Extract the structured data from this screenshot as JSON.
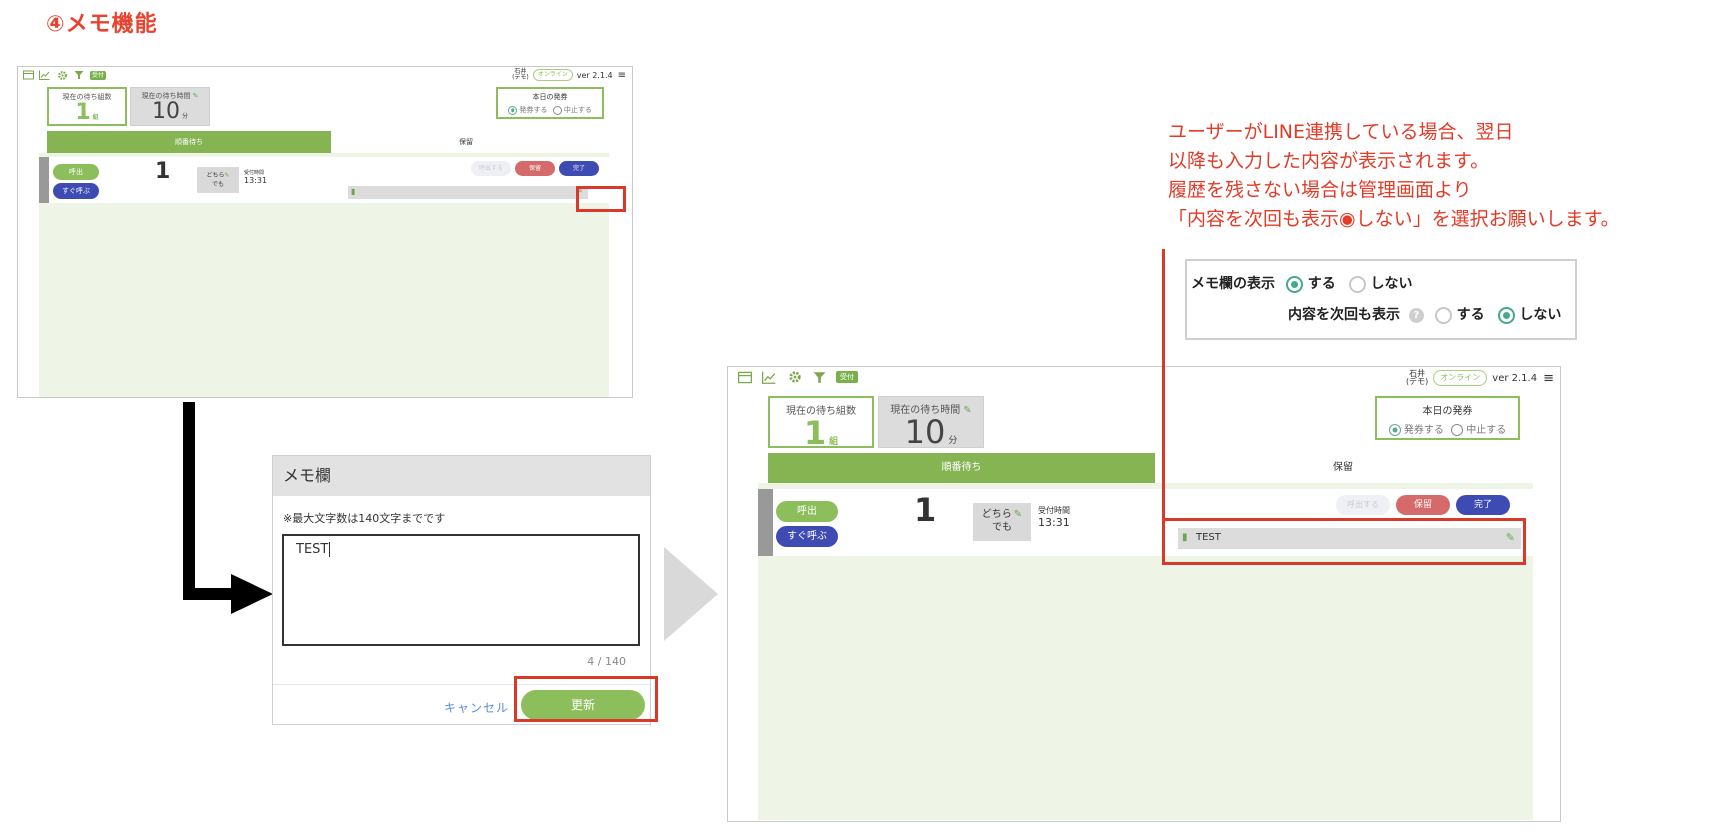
{
  "heading": "④メモ機能",
  "app": {
    "status_badge": "受付",
    "user_name": "石井",
    "user_sub": "(デモ)",
    "online": "オンライン",
    "version": "ver 2.1.4",
    "waiting_groups_label": "現在の待ち組数",
    "waiting_groups_value": "1",
    "waiting_groups_unit": "組",
    "waiting_time_label": "現在の待ち時間",
    "waiting_time_value": "10",
    "waiting_time_unit": "分",
    "issue_title": "本日の発券",
    "issue_on": "発券する",
    "issue_off": "中止する",
    "tab_queue": "順番待ち",
    "tab_hold": "保留",
    "row_number": "1",
    "call_button": "呼出",
    "call_now_button": "すぐ呼ぶ",
    "who_line1": "どちら",
    "who_line2": "でも",
    "reception_time_label": "受付時間",
    "reception_time": "13:31",
    "hold_button": "保留",
    "done_button": "完了",
    "faded_button": "呼出する",
    "memo_value": "TEST"
  },
  "dialog": {
    "title": "メモ欄",
    "hint": "※最大文字数は140文字までです",
    "text": "TEST",
    "counter": "4 / 140",
    "cancel": "キャンセル",
    "update": "更新"
  },
  "annotation": {
    "text": "ユーザーがLINE連携している場合、翌日\n以降も入力した内容が表示されます。\n履歴を残さない場合は管理画面より\n「内容を次回も表示◉しない」を選択お願いします。"
  },
  "settings": {
    "memo_display_label": "メモ欄の表示",
    "carry_over_label": "内容を次回も表示",
    "yes": "する",
    "no": "しない",
    "help": "?"
  },
  "colors": {
    "accent_green": "#8cbf5b",
    "indigo": "#3e4bb3",
    "highlight_red": "#d83a2a",
    "annotation_red": "#e23b27"
  }
}
